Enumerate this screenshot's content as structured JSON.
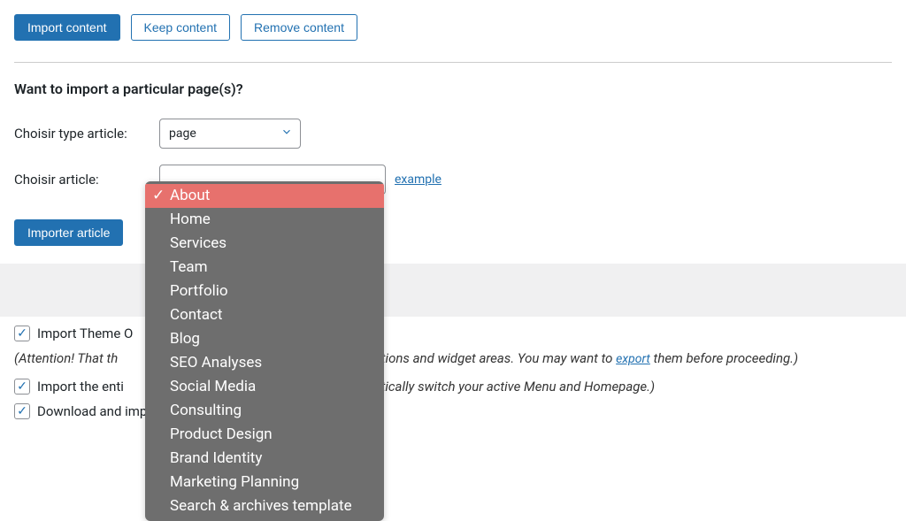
{
  "buttons": {
    "import_content": "Import content",
    "keep_content": "Keep content",
    "remove_content": "Remove content",
    "importer_article": "Importer article"
  },
  "section": {
    "title": "Want to import a particular page(s)?"
  },
  "form": {
    "type_label": "Choisir type article:",
    "type_value": "page",
    "article_label": "Choisir article:",
    "example_link": "example"
  },
  "dropdown": {
    "items": [
      "About",
      "Home",
      "Services",
      "Team",
      "Portfolio",
      "Contact",
      "Blog",
      "SEO Analyses",
      "Social Media",
      "Consulting",
      "Product Design",
      "Brand Identity",
      "Marketing Planning",
      "Search & archives template"
    ],
    "selected_index": 0
  },
  "checkboxes": {
    "import_theme_label": "Import Theme O",
    "import_menu_label_prefix": "Import the enti",
    "import_menu_label_suffix": "matically switch your active Menu and Homepage.)",
    "download_label": "Download and import file attachments"
  },
  "warning": {
    "prefix": "(Attention! That th",
    "mid": "e Options and widget areas. You may want to ",
    "link": "export",
    "suffix": " them before proceeding.)"
  }
}
